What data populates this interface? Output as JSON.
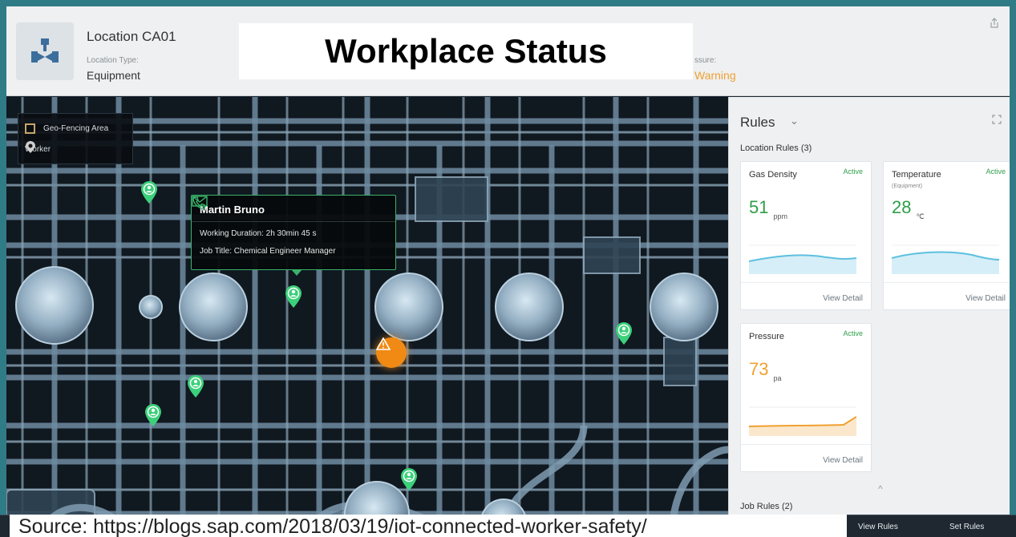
{
  "header": {
    "location_title": "Location CA01",
    "location_type_label": "Location Type:",
    "location_type_value": "Equipment",
    "pressure_label": "ssure:",
    "pressure_value": "Warning",
    "icon": "valve-icon",
    "share_icon": "share-icon"
  },
  "overlay": {
    "title": "Workplace Status"
  },
  "map": {
    "legend": {
      "geo_fencing": "Geo-Fencing Area",
      "worker": "Worker"
    },
    "popup": {
      "name": "Martin Bruno",
      "duration": "Working Duration:  2h 30min 45 s",
      "job_title": "Job Title: Chemical Engineer Manager",
      "phone_icon": "phone-icon",
      "mail_icon": "mail-icon"
    },
    "alert_icon": "warning-icon",
    "worker_count": 7
  },
  "rules": {
    "title": "Rules",
    "location_rules_label": "Location Rules (3)",
    "job_rules_label": "Job Rules (2)",
    "cards": [
      {
        "name": "Gas Density",
        "status": "Active",
        "sub": "",
        "value": "51",
        "unit": "ppm",
        "link": "View Detail",
        "color": "#2f9e4a",
        "spark_color": "#5cc0df"
      },
      {
        "name": "Temperature",
        "status": "Active",
        "sub": "(Equipment)",
        "value": "28",
        "unit": "℃",
        "link": "View Detail",
        "color": "#2f9e4a",
        "spark_color": "#5cc0df"
      },
      {
        "name": "Pressure",
        "status": "Active",
        "sub": "",
        "value": "73",
        "unit": "pa",
        "link": "View Detail",
        "color": "#f0a030",
        "spark_color": "#f0a030"
      }
    ]
  },
  "footer": {
    "source": "Source: https://blogs.sap.com/2018/03/19/iot-connected-worker-safety/",
    "view_rules": "View Rules",
    "set_rules": "Set Rules"
  },
  "colors": {
    "accent_green": "#39b36a",
    "warning_orange": "#f08a15",
    "teal_border": "#2f7c86"
  }
}
